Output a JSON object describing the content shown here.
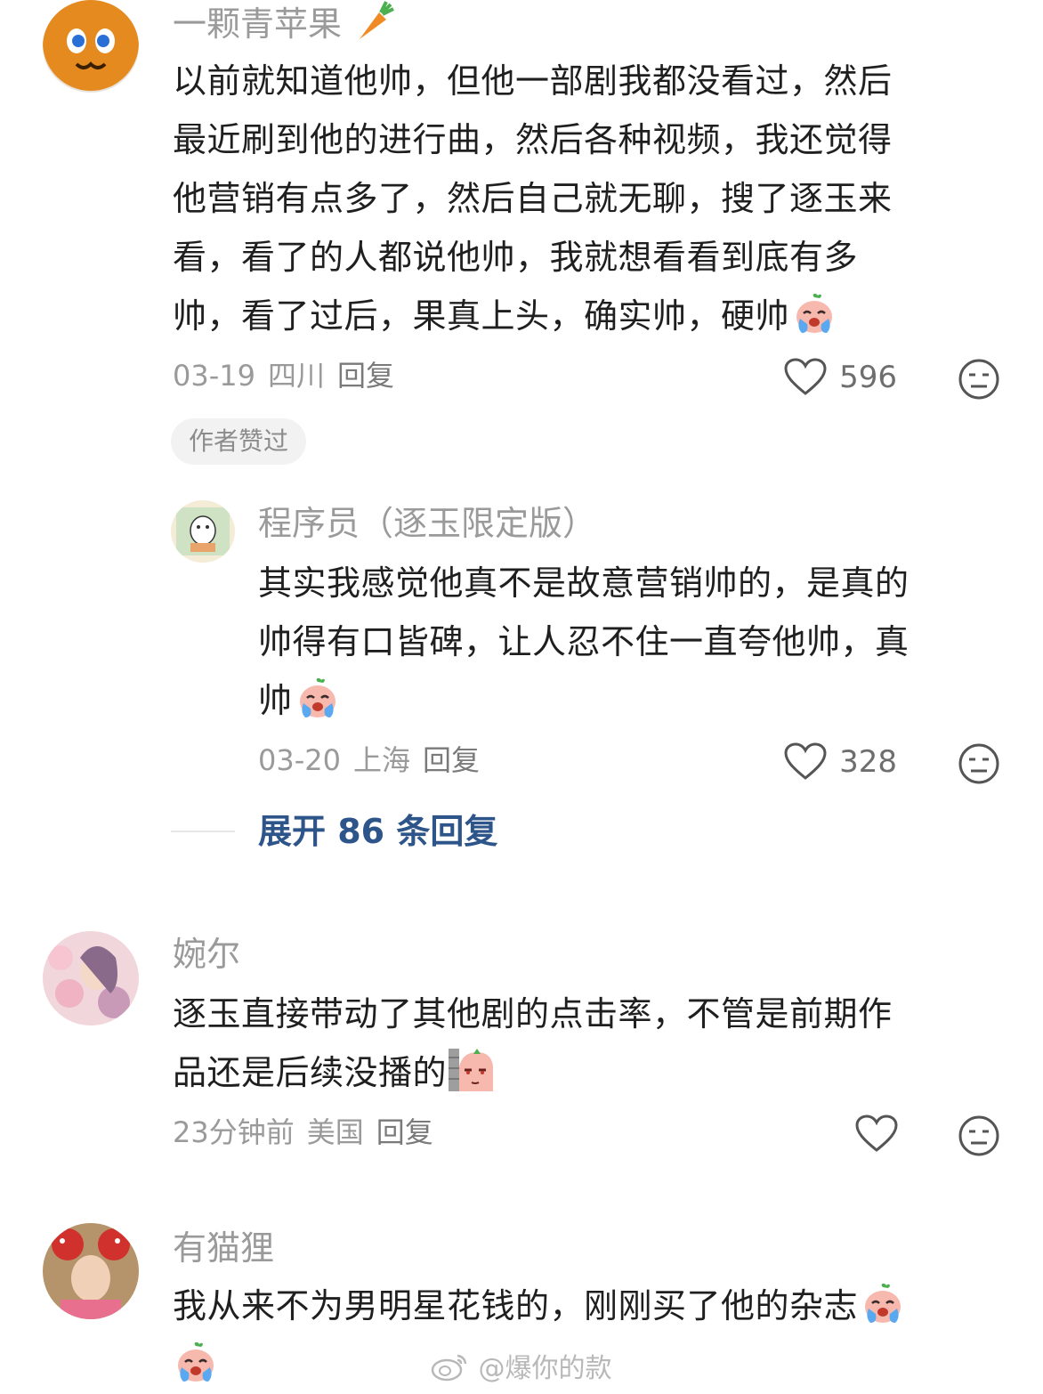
{
  "comments": [
    {
      "username": "一颗青苹果",
      "lines": [
        "以前就知道他帅，但他一部剧我都没看过，然后",
        "最近刷到他的进行曲，然后各种视频，我还觉得",
        "他营销有点多了，然后自己就无聊，搜了逐玉来",
        "看，看了的人都说他帅，我就想看看到底有多",
        "帅，看了过后，果真上头，确实帅，硬帅"
      ],
      "date": "03-19",
      "location": "四川",
      "reply_label": "回复",
      "likes": "596",
      "badge": "作者赞过"
    },
    {
      "username": "婉尔",
      "lines": [
        "逐玉直接带动了其他剧的点击率，不管是前期作",
        "品还是后续没播的"
      ],
      "date": "23分钟前",
      "location": "美国",
      "reply_label": "回复",
      "likes": ""
    },
    {
      "username": "有猫狸",
      "lines": [
        "我从来不为男明星花钱的，刚刚买了他的杂志"
      ]
    }
  ],
  "reply": {
    "username": "程序员（逐玉限定版）",
    "lines": [
      "其实我感觉他真不是故意营销帅的，是真的",
      "帅得有口皆碑，让人忍不住一直夸他帅，真",
      "帅"
    ],
    "date": "03-20",
    "location": "上海",
    "reply_label": "回复",
    "likes": "328"
  },
  "expand_replies_label": "展开 86 条回复",
  "watermark": "@爆你的款",
  "icons": [
    "heart-outline-icon",
    "neutral-face-icon",
    "crying-emoji-icon",
    "peek-emoji-icon",
    "carrot-emoji-icon",
    "weibo-logo-icon"
  ],
  "colors": {
    "username": "#9a9a9a",
    "link": "#2e5589",
    "meta": "#9a9a9a"
  }
}
